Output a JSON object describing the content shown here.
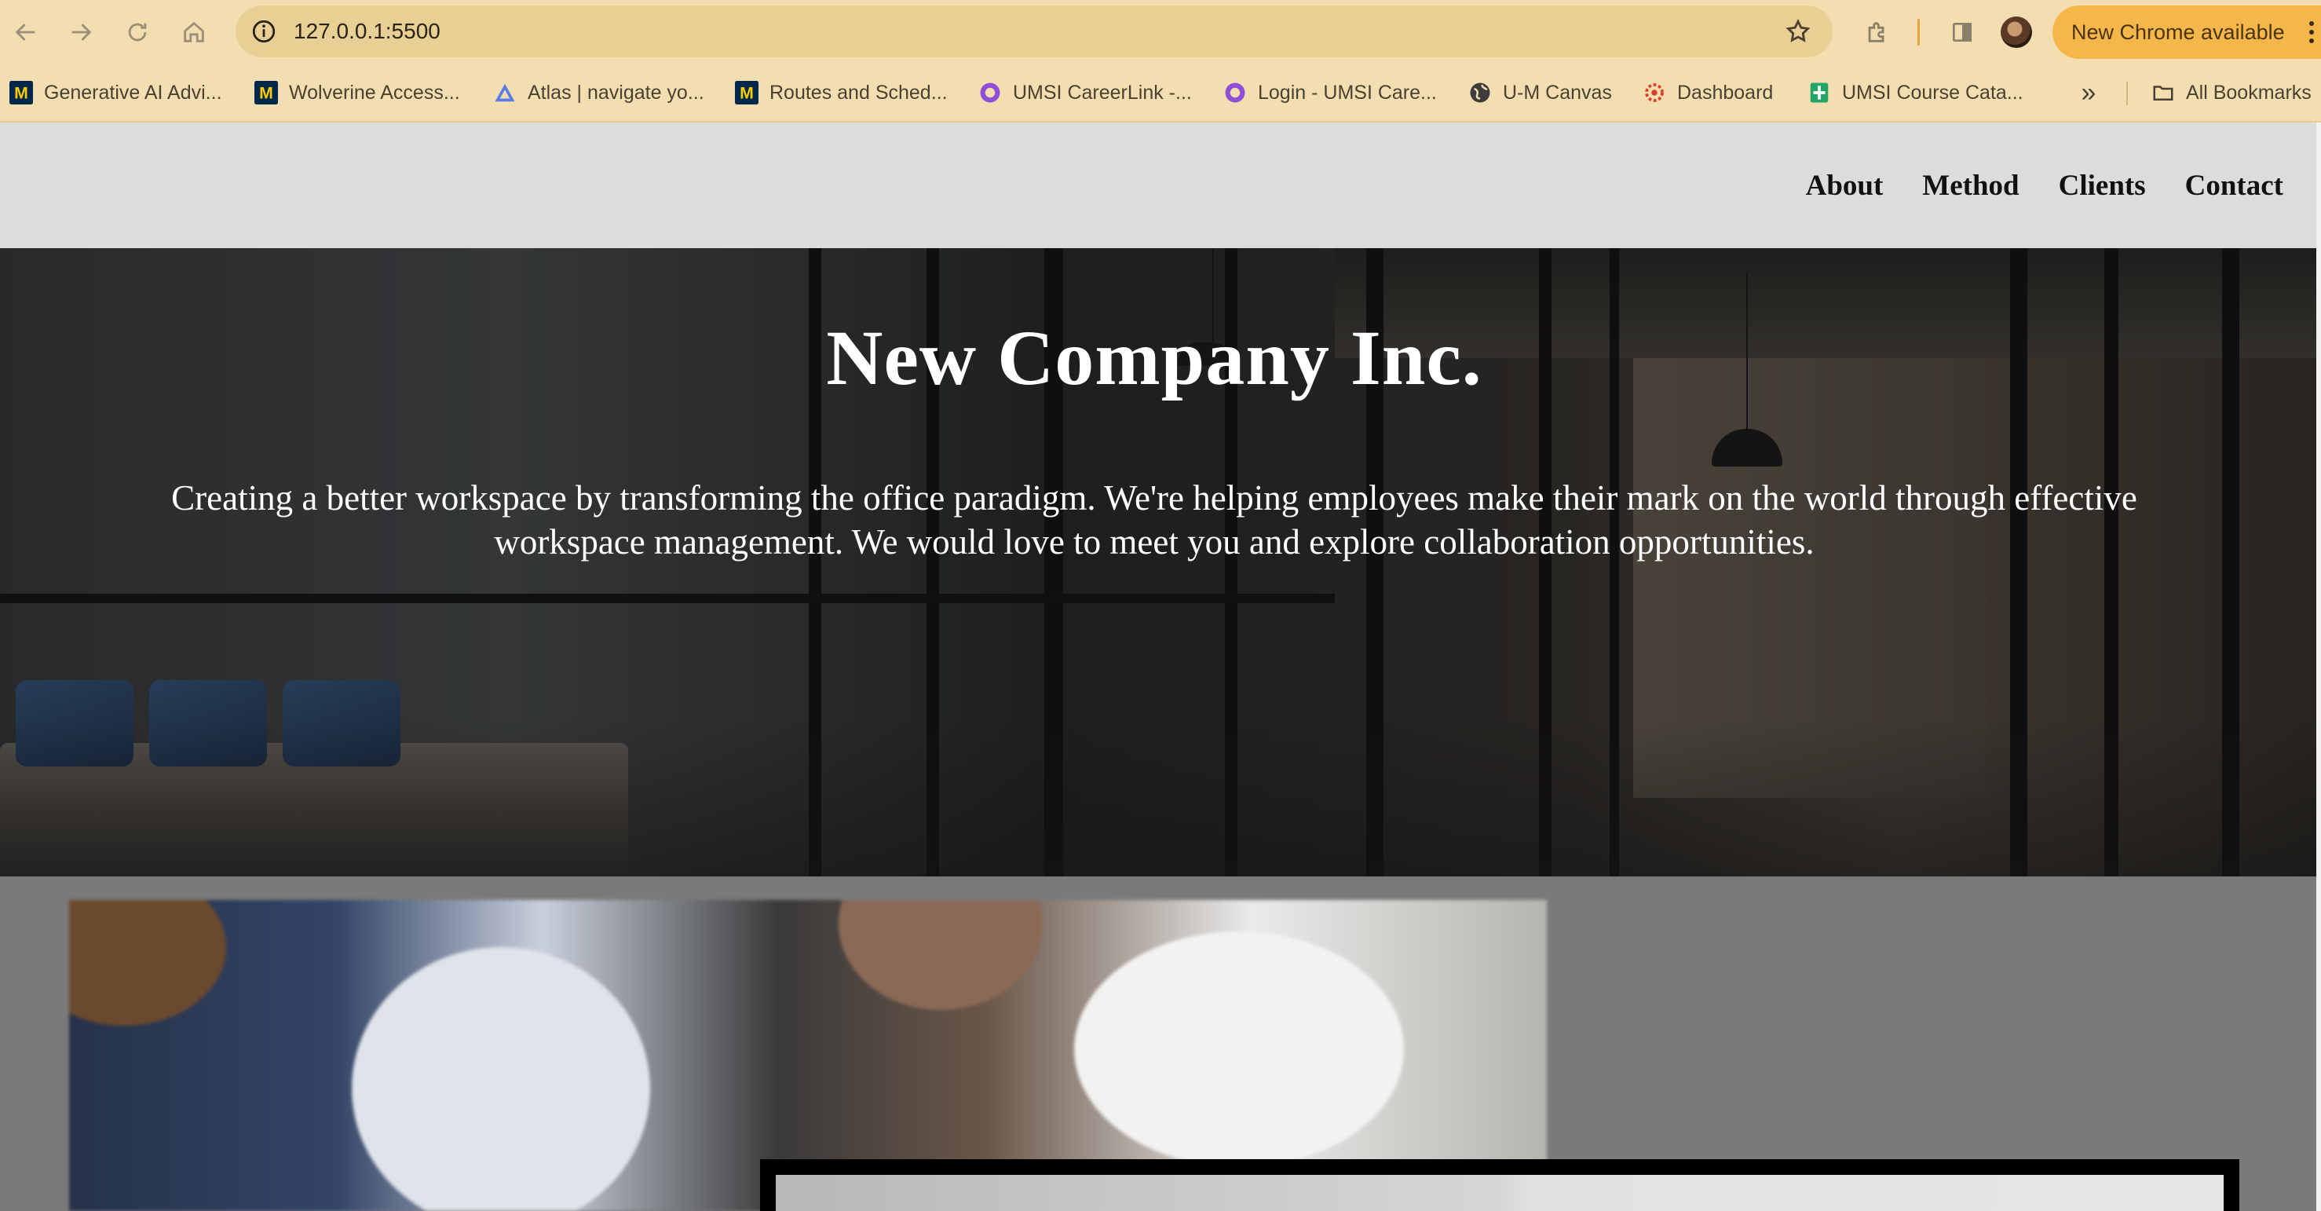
{
  "browser": {
    "url": "127.0.0.1:5500",
    "update_label": "New Chrome available",
    "bookmarks": [
      {
        "label": "Generative AI Advi...",
        "icon": "umich-m-icon"
      },
      {
        "label": "Wolverine Access...",
        "icon": "umich-m-icon"
      },
      {
        "label": "Atlas | navigate yo...",
        "icon": "atlas-triangle-icon"
      },
      {
        "label": "Routes and Sched...",
        "icon": "umich-m-icon"
      },
      {
        "label": "UMSI CareerLink -...",
        "icon": "careerlink-icon"
      },
      {
        "label": "Login - UMSI Care...",
        "icon": "careerlink-icon"
      },
      {
        "label": "U-M Canvas",
        "icon": "globe-icon"
      },
      {
        "label": "Dashboard",
        "icon": "canvas-icon"
      },
      {
        "label": "UMSI Course Cata...",
        "icon": "sheets-icon"
      }
    ],
    "all_bookmarks_label": "All Bookmarks"
  },
  "site": {
    "nav": [
      "About",
      "Method",
      "Clients",
      "Contact"
    ],
    "hero_title": "New Company Inc.",
    "hero_text": "Creating a better workspace by transforming the office paradigm. We're helping employees make their mark on the world through effective workspace management. We would love to meet you and explore collaboration opportunities."
  }
}
